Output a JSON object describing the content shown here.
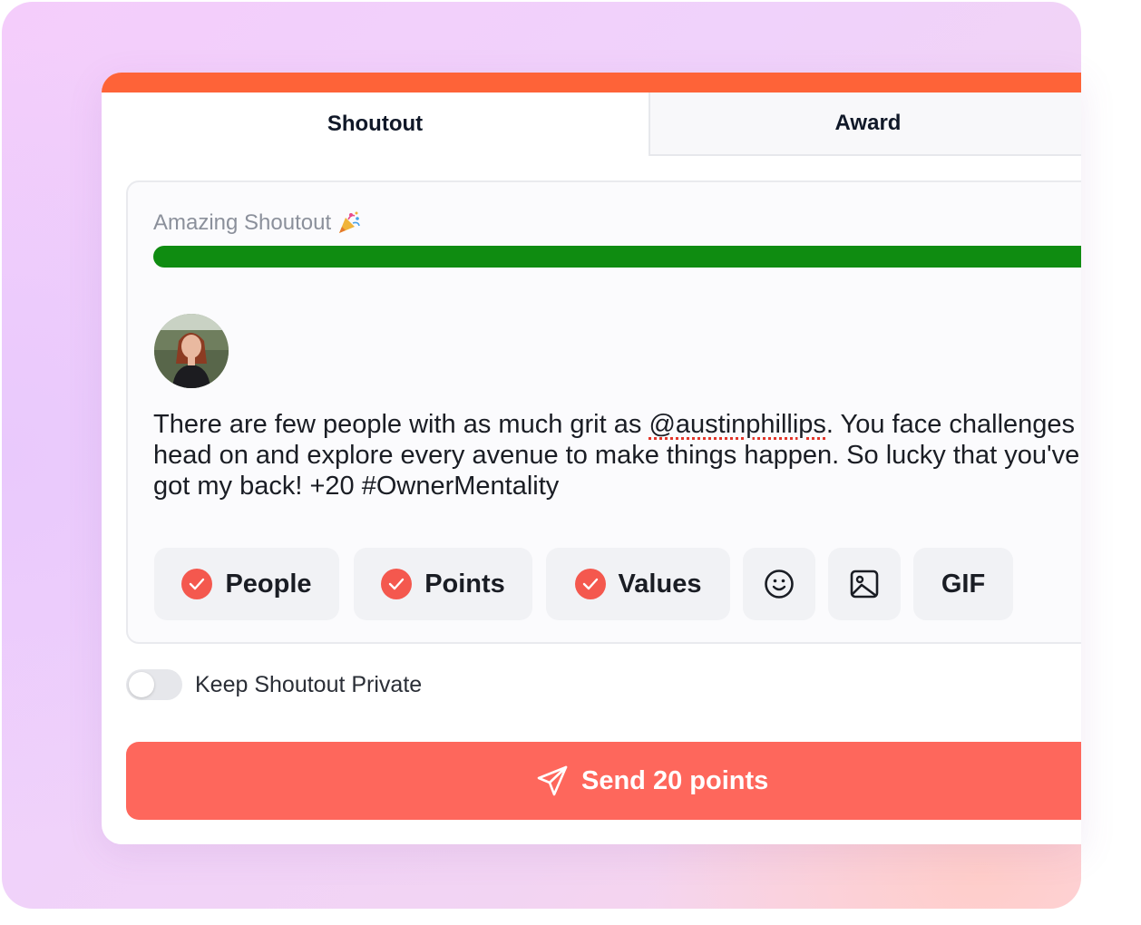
{
  "tabs": [
    {
      "label": "Shoutout",
      "active": true
    },
    {
      "label": "Award",
      "active": false
    }
  ],
  "editor": {
    "title": "Amazing Shoutout",
    "title_icon": "party-popper-icon",
    "progress_fraction": 1.0,
    "avatar_icon": "user-avatar-photo",
    "message_prefix": "There are few people with as much grit as ",
    "mention": "@austinphillips",
    "message_suffix": ". You face challenges head on and explore every avenue to make things happen. So lucky that you've got my back! +20 #OwnerMentality",
    "chips": {
      "people": "People",
      "points": "Points",
      "values": "Values",
      "emoji_icon": "smiley-icon",
      "image_icon": "image-icon",
      "gif": "GIF"
    }
  },
  "private_toggle": {
    "label": "Keep Shoutout Private",
    "on": false
  },
  "send_button": {
    "label": "Send 20 points",
    "icon": "paper-plane-icon"
  },
  "colors": {
    "accent_top": "#fe6338",
    "progress": "#0f8c11",
    "check": "#f4584e",
    "send": "#fe675c"
  }
}
